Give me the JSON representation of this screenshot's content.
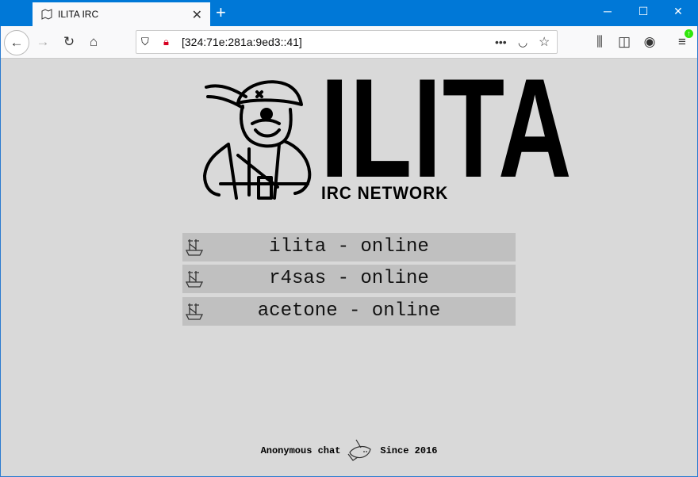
{
  "browser": {
    "tab_title": "ILITA IRC",
    "url": "[324:71e:281a:9ed3::41]"
  },
  "logo": {
    "title": "ILITA",
    "subtitle": "IRC NETWORK"
  },
  "servers": [
    {
      "label": "ilita - online"
    },
    {
      "label": "r4sas - online"
    },
    {
      "label": "acetone - online"
    }
  ],
  "footer": {
    "left": "Anonymous chat",
    "right": "Since 2016"
  }
}
